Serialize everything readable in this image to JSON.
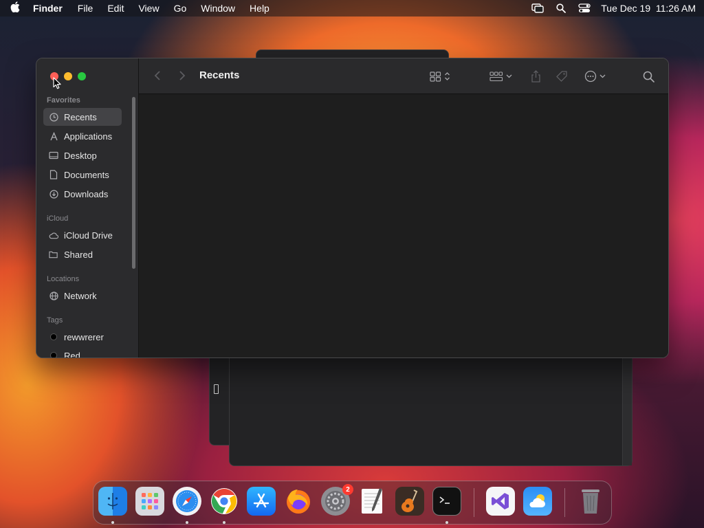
{
  "menubar": {
    "app_name": "Finder",
    "items": [
      "File",
      "Edit",
      "View",
      "Go",
      "Window",
      "Help"
    ],
    "datetime": "Tue Dec 19  11:26 AM"
  },
  "finder": {
    "title": "Recents",
    "sidebar": {
      "favorites_header": "Favorites",
      "favorites": [
        "Recents",
        "Applications",
        "Desktop",
        "Documents",
        "Downloads"
      ],
      "icloud_header": "iCloud",
      "icloud": [
        "iCloud Drive",
        "Shared"
      ],
      "locations_header": "Locations",
      "locations": [
        "Network"
      ],
      "tags_header": "Tags",
      "tags": [
        "rewwrerer",
        "Red"
      ]
    }
  },
  "dock": {
    "apps": [
      "Finder",
      "Launchpad",
      "Safari",
      "Chrome",
      "App Store",
      "Firefox",
      "System Settings",
      "TextEdit",
      "GarageBand",
      "Terminal",
      "Visual Studio",
      "Weather",
      "Trash"
    ],
    "settings_badge": "2"
  },
  "colors": {
    "close": "#ff5f57",
    "minimize": "#febc2e",
    "maximize": "#28c840",
    "selection": "#434346"
  }
}
